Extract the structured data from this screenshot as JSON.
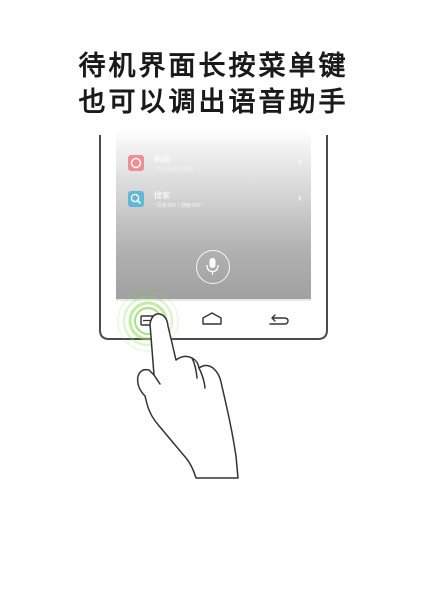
{
  "caption": {
    "line1": "待机界面长按菜单键",
    "line2": "也可以调出语音助手"
  },
  "screen": {
    "rows": [
      {
        "title": "新闻",
        "subtitle": "“今天有什么新闻？”",
        "icon": "news-icon",
        "color": "#ef8d94"
      },
      {
        "title": "搜索",
        "subtitle": "“百度360 / 搜索360”",
        "icon": "search-icon",
        "color": "#5fb8d8"
      }
    ],
    "mic_icon": "microphone-icon"
  },
  "nav_bar": {
    "menu_icon": "menu-icon",
    "home_icon": "home-icon",
    "back_icon": "back-icon",
    "highlight_color": "#8ddc57"
  }
}
